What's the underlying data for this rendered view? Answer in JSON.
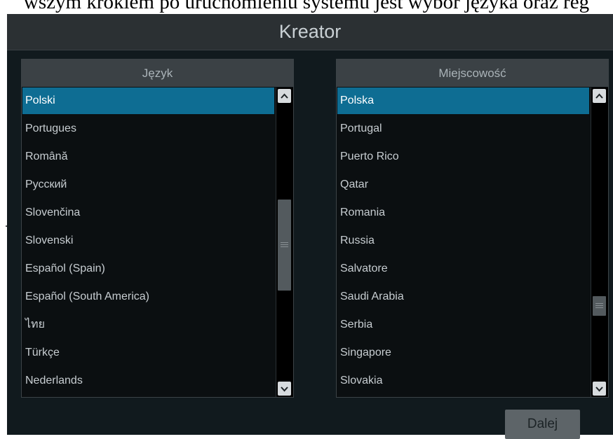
{
  "doc_text": "wszym krokiem po uruchomieniu systemu jest wybór języka oraz reg",
  "window": {
    "title": "Kreator"
  },
  "language_panel": {
    "header": "Język",
    "items": [
      {
        "label": "Polski",
        "selected": true
      },
      {
        "label": "Portugues",
        "selected": false
      },
      {
        "label": "Română",
        "selected": false
      },
      {
        "label": "Русский",
        "selected": false
      },
      {
        "label": "Slovenčina",
        "selected": false
      },
      {
        "label": "Slovenski",
        "selected": false
      },
      {
        "label": "Español (Spain)",
        "selected": false
      },
      {
        "label": "Español (South America)",
        "selected": false
      },
      {
        "label": "ไทย",
        "selected": false
      },
      {
        "label": "Türkçe",
        "selected": false
      },
      {
        "label": "Nederlands",
        "selected": false
      }
    ]
  },
  "location_panel": {
    "header": "Miejscowość",
    "items": [
      {
        "label": "Polska",
        "selected": true
      },
      {
        "label": "Portugal",
        "selected": false
      },
      {
        "label": "Puerto Rico",
        "selected": false
      },
      {
        "label": "Qatar",
        "selected": false
      },
      {
        "label": "Romania",
        "selected": false
      },
      {
        "label": "Russia",
        "selected": false
      },
      {
        "label": "Salvatore",
        "selected": false
      },
      {
        "label": "Saudi Arabia",
        "selected": false
      },
      {
        "label": "Serbia",
        "selected": false
      },
      {
        "label": "Singapore",
        "selected": false
      },
      {
        "label": "Slovakia",
        "selected": false
      }
    ]
  },
  "icons": {
    "scroll_up": "chevron-up-icon",
    "scroll_down": "chevron-down-icon"
  },
  "colors": {
    "selection": "#0e6d93",
    "window_bg": "#111a1e",
    "header_bg": "#3b4145"
  },
  "footer": {
    "next_label": "Dalej"
  }
}
